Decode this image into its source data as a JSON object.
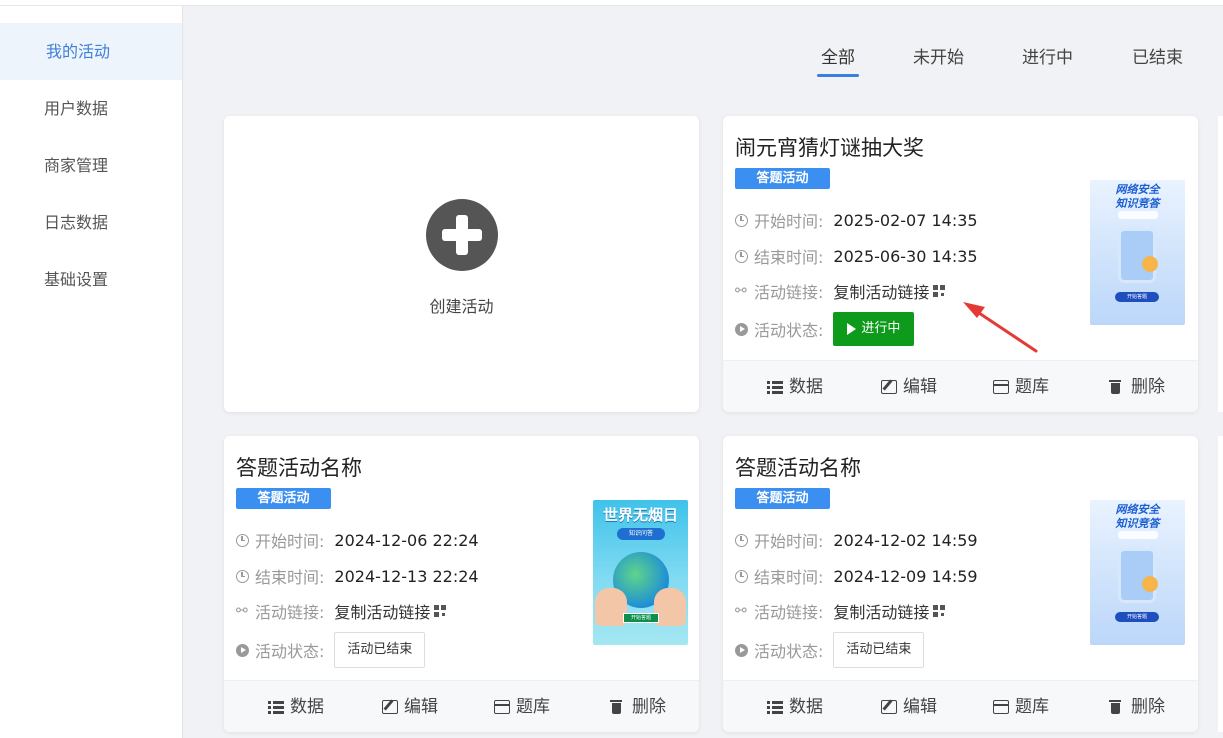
{
  "sidebar": {
    "items": [
      {
        "label": "我的活动",
        "active": true
      },
      {
        "label": "用户数据"
      },
      {
        "label": "商家管理"
      },
      {
        "label": "日志数据"
      },
      {
        "label": "基础设置"
      }
    ]
  },
  "tabs": [
    {
      "label": "全部",
      "active": true
    },
    {
      "label": "未开始"
    },
    {
      "label": "进行中"
    },
    {
      "label": "已结束"
    }
  ],
  "create_card": {
    "label": "创建活动",
    "icon": "plus-circle-icon"
  },
  "labels": {
    "start": "开始时间:",
    "end": "结束时间:",
    "link": "活动链接:",
    "status": "活动状态:",
    "copy_link": "复制活动链接"
  },
  "actions": {
    "data": "数据",
    "edit": "编辑",
    "bank": "题库",
    "delete": "删除"
  },
  "activities": [
    {
      "title": "闹元宵猜灯谜抽大奖",
      "type": "答题活动",
      "start": "2025-02-07 14:35",
      "end": "2025-06-30 14:35",
      "status": "进行中",
      "status_color": "#0e9a1a",
      "poster": {
        "line1": "网络安全",
        "line2": "知识竞答",
        "button": "开始答题"
      }
    },
    {
      "title": "答题活动名称",
      "type": "答题活动",
      "start": "2024-12-06 22:24",
      "end": "2024-12-13 22:24",
      "status": "活动已结束",
      "poster": {
        "line1": "世界无烟日",
        "line2": "知识问答",
        "button": "开始答题"
      }
    },
    {
      "title": "答题活动名称",
      "type": "答题活动",
      "start": "2024-12-02 14:59",
      "end": "2024-12-09 14:59",
      "status": "活动已结束",
      "poster": {
        "line1": "网络安全",
        "line2": "知识竞答",
        "button": "开始答题"
      }
    }
  ],
  "colors": {
    "accent": "#3b7fde",
    "badge": "#3b8ff0",
    "running": "#0e9a1a",
    "annotation_arrow": "#e53935"
  }
}
